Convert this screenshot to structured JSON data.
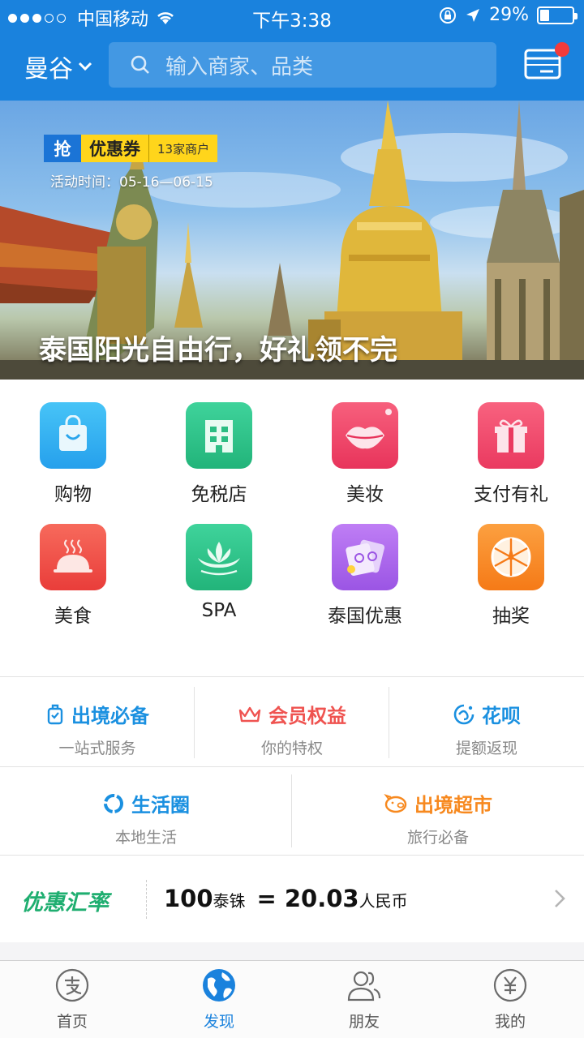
{
  "status_bar": {
    "carrier": "中国移动",
    "time": "下午3:38",
    "battery": "29%",
    "battery_level": 0.29
  },
  "header": {
    "city": "曼谷",
    "search_placeholder": "输入商家、品类"
  },
  "banner": {
    "tag_grab": "抢",
    "tag_coupon": "优惠券",
    "tag_merchants": "13家商户",
    "activity_time": "活动时间：05-16—06-15",
    "title": "泰国阳光自由行，好礼领不完"
  },
  "grid": {
    "items": [
      {
        "label": "购物",
        "icon": "shopping-bag-icon",
        "color": "#35b3f0"
      },
      {
        "label": "免税店",
        "icon": "building-icon",
        "color": "#2fc289"
      },
      {
        "label": "美妆",
        "icon": "lips-icon",
        "color": "#f0456a"
      },
      {
        "label": "支付有礼",
        "icon": "gift-icon",
        "color": "#f3476b"
      },
      {
        "label": "美食",
        "icon": "dish-icon",
        "color": "#f0504d"
      },
      {
        "label": "SPA",
        "icon": "lotus-icon",
        "color": "#2dbe86"
      },
      {
        "label": "泰国优惠",
        "icon": "coupons-icon",
        "color": "#a762e8"
      },
      {
        "label": "抽奖",
        "icon": "wheel-icon",
        "color": "#f98a20"
      }
    ]
  },
  "services": {
    "items": [
      {
        "title": "出境必备",
        "subtitle": "一站式服务",
        "icon": "luggage-icon",
        "color": "#1a90e0"
      },
      {
        "title": "会员权益",
        "subtitle": "你的特权",
        "icon": "crown-icon",
        "color": "#ef5350"
      },
      {
        "title": "花呗",
        "subtitle": "提额返现",
        "icon": "huabei-icon",
        "color": "#1a90e0"
      },
      {
        "title": "生活圈",
        "subtitle": "本地生活",
        "icon": "circle-icon",
        "color": "#1a90e0"
      },
      {
        "title": "出境超市",
        "subtitle": "旅行必备",
        "icon": "pig-icon",
        "color": "#f7891f"
      }
    ]
  },
  "exchange": {
    "brand": "优惠汇率",
    "amount": "100",
    "from_currency": "泰铢",
    "equals": "=",
    "result": "20.03",
    "to_currency": "人民币"
  },
  "tabbar": {
    "tabs": [
      {
        "label": "首页",
        "icon": "alipay-home-icon",
        "active": false
      },
      {
        "label": "发现",
        "icon": "globe-icon",
        "active": true
      },
      {
        "label": "朋友",
        "icon": "friends-icon",
        "active": false
      },
      {
        "label": "我的",
        "icon": "yuan-icon",
        "active": false
      }
    ],
    "active_color": "#1a82dd"
  }
}
